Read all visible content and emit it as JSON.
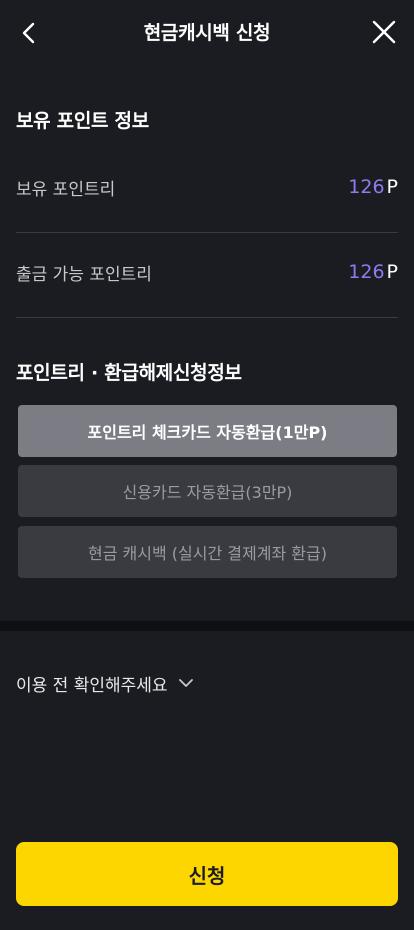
{
  "header": {
    "title": "현금캐시백 신청"
  },
  "points_info": {
    "section_title": "보유 포인트 정보",
    "held": {
      "label": "보유 포인트리",
      "value": "126",
      "unit": "P"
    },
    "withdrawable": {
      "label": "출금 가능 포인트리",
      "value": "126",
      "unit": "P"
    }
  },
  "refund_info": {
    "section_title": "포인트리 · 환급해제신청정보",
    "options": [
      {
        "label": "포인트리 체크카드 자동환급(1만P)",
        "selected": true
      },
      {
        "label": "신용카드 자동환급(3만P)",
        "selected": false
      },
      {
        "label": "현금 캐시백 (실시간 결제계좌 환급)",
        "selected": false
      }
    ]
  },
  "notice": {
    "label": "이용 전 확인해주세요"
  },
  "submit": {
    "label": "신청"
  },
  "colors": {
    "background": "#1b1c21",
    "accent_value": "#8b7cf0",
    "button": "#fdd600"
  }
}
